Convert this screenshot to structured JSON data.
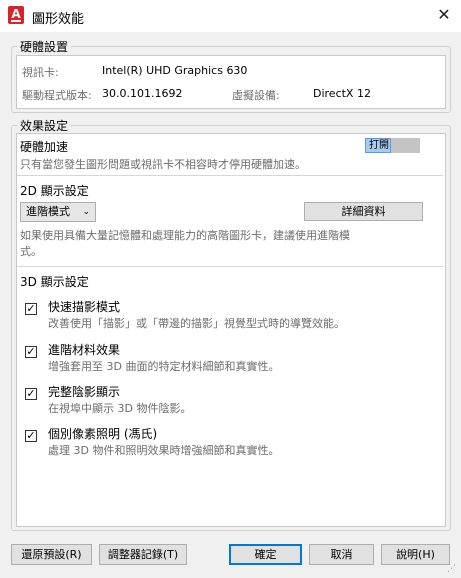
{
  "window": {
    "title": "圖形效能",
    "close_glyph": "✕",
    "icon_letter": "A"
  },
  "hardware": {
    "legend": "硬體設置",
    "video_card_label": "視訊卡:",
    "video_card_value": "Intel(R) UHD Graphics 630",
    "driver_label": "驅動程式版本:",
    "driver_value": "30.0.101.1692",
    "virtual_label": "虛擬設備:",
    "virtual_value": "DirectX 12"
  },
  "effects": {
    "legend": "效果設定",
    "hw_accel": {
      "title": "硬體加速",
      "desc": "只有當您發生圖形問題或視訊卡不相容時才停用硬體加速。",
      "toggle_label": "打開",
      "enabled": true
    },
    "display2d": {
      "title": "2D 顯示設定",
      "mode_value": "進階模式",
      "details_button": "詳細資料",
      "desc": "如果使用具備大量記憶體和處理能力的高階圖形卡，建議使用進階模式。"
    },
    "display3d": {
      "title": "3D 顯示設定",
      "options": [
        {
          "title": "快速描影模式",
          "desc": "改善使用「描影」或「帶邊的描影」視覺型式時的導覽效能。",
          "checked": true
        },
        {
          "title": "進階材料效果",
          "desc": "增強套用至 3D 曲面的特定材料細節和真實性。",
          "checked": true
        },
        {
          "title": "完整陰影顯示",
          "desc": "在視埠中顯示 3D 物件陰影。",
          "checked": true
        },
        {
          "title": "個別像素照明 (馮氏)",
          "desc": "處理 3D 物件和照明效果時增強細節和真實性。",
          "checked": true
        }
      ]
    }
  },
  "footer": {
    "restore": "還原預設(R)",
    "tuner_log": "調整器記錄(T)",
    "ok": "確定",
    "cancel": "取消",
    "help": "說明(H)"
  },
  "icons": {
    "checkmark": "✓",
    "dropdown": "chevron-down-icon",
    "close": "close-icon",
    "app": "autocad-logo-icon"
  }
}
